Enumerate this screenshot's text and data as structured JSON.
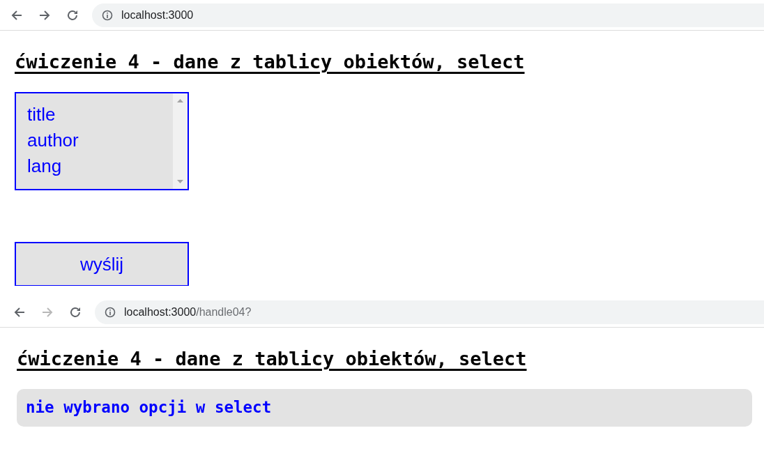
{
  "windows": [
    {
      "address": {
        "host": "localhost:3000"
      },
      "forward_disabled": false,
      "heading": "ćwiczenie 4 - dane z tablicy obiektów, select",
      "kind": "form",
      "select": {
        "options": [
          {
            "label": "title",
            "selected": false
          },
          {
            "label": "author",
            "selected": false
          },
          {
            "label": "lang",
            "selected": false
          }
        ]
      },
      "submit_button": "wyślij"
    },
    {
      "address": {
        "host": "localhost:3000",
        "path": "/handle04?"
      },
      "forward_disabled": true,
      "heading": "ćwiczenie 4 - dane z tablicy obiektów, select",
      "kind": "result",
      "message": "nie wybrano opcji w select"
    }
  ]
}
